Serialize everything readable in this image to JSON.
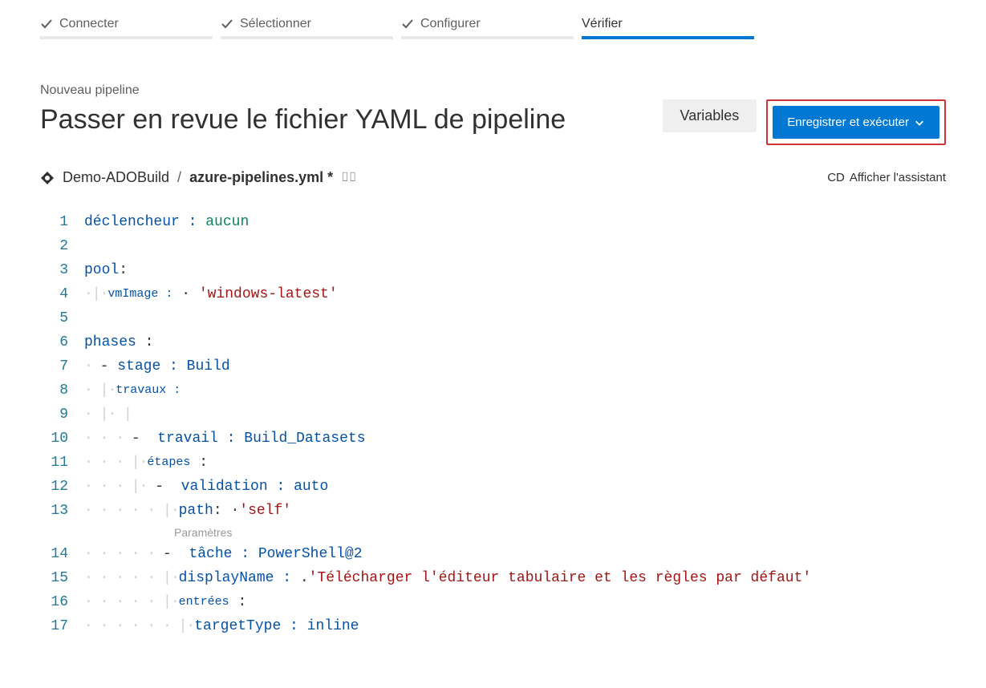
{
  "wizard": {
    "steps": [
      {
        "label": "Connecter",
        "done": true,
        "active": false
      },
      {
        "label": "Sélectionner",
        "done": true,
        "active": false
      },
      {
        "label": "Configurer",
        "done": true,
        "active": false
      },
      {
        "label": "Vérifier",
        "done": false,
        "active": true
      }
    ]
  },
  "header": {
    "subtitle": "Nouveau pipeline",
    "title": "Passer en revue le fichier YAML de pipeline",
    "variables_button": "Variables",
    "save_run_button": "Enregistrer et exécuter"
  },
  "breadcrumb": {
    "repo": "Demo-ADOBuild",
    "separator": "/",
    "file": "azure-pipelines.yml *"
  },
  "assistant_link": "Afficher l'assistant",
  "assistant_prefix": "CD",
  "params_label": "Paramètres",
  "code": {
    "lines": [
      {
        "num": 1,
        "segs": [
          {
            "t": "indent",
            "v": ""
          },
          {
            "t": "key",
            "v": "déclencheur : "
          },
          {
            "t": "val",
            "v": "aucun"
          }
        ]
      },
      {
        "num": 2,
        "segs": []
      },
      {
        "num": 3,
        "segs": [
          {
            "t": "key",
            "v": "pool"
          },
          {
            "t": "punct",
            "v": ":"
          }
        ]
      },
      {
        "num": 4,
        "segs": [
          {
            "t": "guide",
            "v": "·|·"
          },
          {
            "t": "keysm",
            "v": "vmImage :"
          },
          {
            "t": "plain",
            "v": " · "
          },
          {
            "t": "str",
            "v": "'windows-latest'"
          }
        ]
      },
      {
        "num": 5,
        "segs": []
      },
      {
        "num": 6,
        "segs": [
          {
            "t": "key",
            "v": "phases"
          },
          {
            "t": "plain",
            "v": " "
          },
          {
            "t": "punct",
            "v": ":"
          }
        ]
      },
      {
        "num": 7,
        "segs": [
          {
            "t": "guide",
            "v": "· "
          },
          {
            "t": "punct",
            "v": "-"
          },
          {
            "t": "plain",
            "v": " "
          },
          {
            "t": "key",
            "v": "stage :"
          },
          {
            "t": "plain",
            "v": " "
          },
          {
            "t": "key",
            "v": "Build"
          }
        ]
      },
      {
        "num": 8,
        "segs": [
          {
            "t": "guide",
            "v": "· |·"
          },
          {
            "t": "keysm",
            "v": "travaux :"
          }
        ]
      },
      {
        "num": 9,
        "segs": [
          {
            "t": "guide",
            "v": "· |· |"
          }
        ]
      },
      {
        "num": 10,
        "segs": [
          {
            "t": "guide",
            "v": "· · · "
          },
          {
            "t": "punct",
            "v": "-"
          },
          {
            "t": "plain",
            "v": "  "
          },
          {
            "t": "key",
            "v": "travail : "
          },
          {
            "t": "key",
            "v": "Build_Datasets"
          }
        ]
      },
      {
        "num": 11,
        "segs": [
          {
            "t": "guide",
            "v": "· · · |·"
          },
          {
            "t": "keysm",
            "v": "étapes"
          },
          {
            "t": "plain",
            "v": " "
          },
          {
            "t": "punct",
            "v": ":"
          }
        ]
      },
      {
        "num": 12,
        "segs": [
          {
            "t": "guide",
            "v": "· · · |· "
          },
          {
            "t": "punct",
            "v": "-"
          },
          {
            "t": "plain",
            "v": "  "
          },
          {
            "t": "key",
            "v": "validation : "
          },
          {
            "t": "key",
            "v": "auto"
          }
        ]
      },
      {
        "num": 13,
        "segs": [
          {
            "t": "guide",
            "v": "· · · · · |·"
          },
          {
            "t": "key",
            "v": "path"
          },
          {
            "t": "punct",
            "v": ":"
          },
          {
            "t": "plain",
            "v": " ·"
          },
          {
            "t": "str",
            "v": "'self'"
          }
        ]
      },
      {
        "num": 14,
        "segs": [
          {
            "t": "guide",
            "v": "· · · · · "
          },
          {
            "t": "punct",
            "v": "-"
          },
          {
            "t": "plain",
            "v": "  "
          },
          {
            "t": "key",
            "v": "tâche : "
          },
          {
            "t": "key",
            "v": "PowerShell@2"
          }
        ]
      },
      {
        "num": 15,
        "segs": [
          {
            "t": "guide",
            "v": "· · · · · |·"
          },
          {
            "t": "key",
            "v": "displayName :"
          },
          {
            "t": "plain",
            "v": " ."
          },
          {
            "t": "str",
            "v": "'Télécharger l'éditeur tabulaire et les règles par défaut'"
          }
        ]
      },
      {
        "num": 16,
        "segs": [
          {
            "t": "guide",
            "v": "· · · · · |·"
          },
          {
            "t": "keysm",
            "v": "entrées"
          },
          {
            "t": "plain",
            "v": " "
          },
          {
            "t": "punct",
            "v": ":"
          }
        ]
      },
      {
        "num": 17,
        "segs": [
          {
            "t": "guide",
            "v": "· · · · · · |·"
          },
          {
            "t": "key",
            "v": "targetType :"
          },
          {
            "t": "plain",
            "v": " "
          },
          {
            "t": "key",
            "v": "inline"
          }
        ]
      }
    ]
  }
}
